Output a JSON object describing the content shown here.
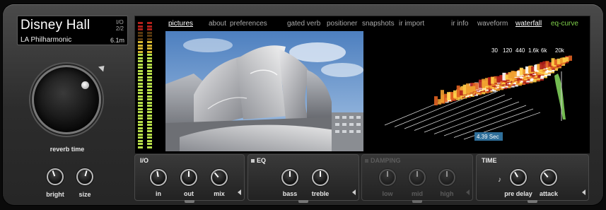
{
  "preset": {
    "name": "Disney Hall",
    "io_top": "I/O",
    "io_bottom": "2/2",
    "subtitle": "LA Philharmonic",
    "length": "6.1m"
  },
  "left": {
    "big_knob_label": "reverb time",
    "bright_label": "bright",
    "size_label": "size"
  },
  "tabs": [
    {
      "label": "pictures",
      "state": "active"
    },
    {
      "label": "about",
      "state": "normal"
    },
    {
      "label": "preferences",
      "state": "normal"
    },
    {
      "label": "gated verb",
      "state": "normal"
    },
    {
      "label": "positioner",
      "state": "normal"
    },
    {
      "label": "snapshots",
      "state": "normal"
    },
    {
      "label": "ir import",
      "state": "normal"
    },
    {
      "label": "ir info",
      "state": "normal"
    },
    {
      "label": "waveform",
      "state": "normal"
    },
    {
      "label": "waterfall",
      "state": "active"
    },
    {
      "label": "eq-curve",
      "state": "green"
    }
  ],
  "waterfall": {
    "freq_labels": [
      "30",
      "120",
      "440",
      "1.6k",
      "6k",
      "20k"
    ],
    "time_readout": "4.39 Sec"
  },
  "panels": {
    "io": {
      "title": "I/O",
      "knobs": [
        "in",
        "out",
        "mix"
      ]
    },
    "eq": {
      "title": "EQ",
      "knobs": [
        "bass",
        "treble"
      ]
    },
    "damping": {
      "title": "DAMPING",
      "knobs": [
        "low",
        "mid",
        "high"
      ]
    },
    "time": {
      "title": "TIME",
      "knobs": [
        "pre delay",
        "attack"
      ]
    }
  },
  "colors": {
    "meter_green": "#b8e04a",
    "meter_red": "#b0201a",
    "accent_green": "#7fd14a",
    "readout_bg": "#2f6f9a"
  }
}
